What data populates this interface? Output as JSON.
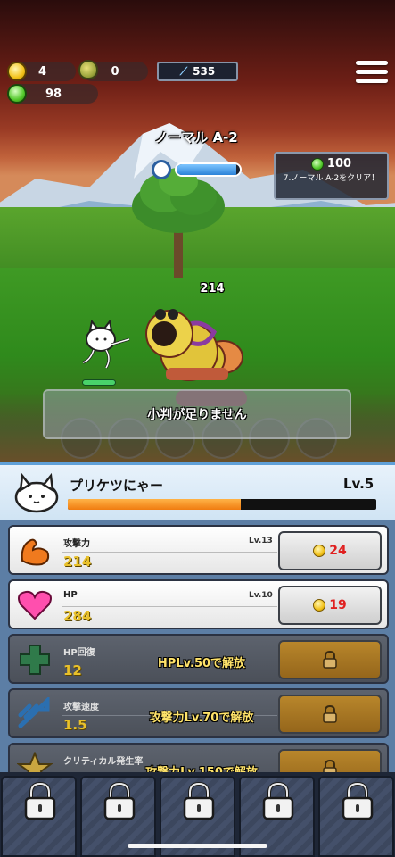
{
  "resources": {
    "coins": "4",
    "fruit": "0",
    "gems": "98",
    "power": "535"
  },
  "stage": {
    "title": "ノーマル A-2",
    "timer_level": 0.95
  },
  "quest": {
    "reward": "100",
    "text": "7.ノーマル A-2をクリア！"
  },
  "battle": {
    "enemy_hp": "214",
    "toast": "小判が足りません",
    "skill_slots": 6
  },
  "character": {
    "name": "プリケツにゃー",
    "level": "Lv.5",
    "xp_progress": 0.56
  },
  "upgrades": [
    {
      "name": "攻撃力",
      "level": "Lv.13",
      "value": "214",
      "cost": "24",
      "locked": false,
      "icon": "muscle-arm-icon"
    },
    {
      "name": "HP",
      "level": "Lv.10",
      "value": "284",
      "cost": "19",
      "locked": false,
      "icon": "heart-icon"
    },
    {
      "name": "HP回復",
      "value": "12",
      "unlock": "HPLv.50で解放",
      "locked": true,
      "icon": "green-cross-icon"
    },
    {
      "name": "攻撃速度",
      "value": "1.5",
      "unlock": "攻撃力Lv.70で解放",
      "locked": true,
      "icon": "speed-arrow-icon"
    },
    {
      "name": "クリティカル発生率",
      "value": "",
      "unlock": "攻撃力Lv.150で解放",
      "locked": true,
      "icon": "star-icon"
    }
  ],
  "tabs": [
    {
      "name": "tab-1",
      "locked": true
    },
    {
      "name": "tab-2",
      "locked": true
    },
    {
      "name": "tab-3",
      "locked": true
    },
    {
      "name": "tab-4",
      "locked": true
    },
    {
      "name": "tab-5",
      "locked": true
    }
  ],
  "colors": {
    "accent_gold": "#e9c12a",
    "cost_red": "#e02020",
    "xp_orange": "#f07c10",
    "timer_blue": "#2b83d8"
  }
}
